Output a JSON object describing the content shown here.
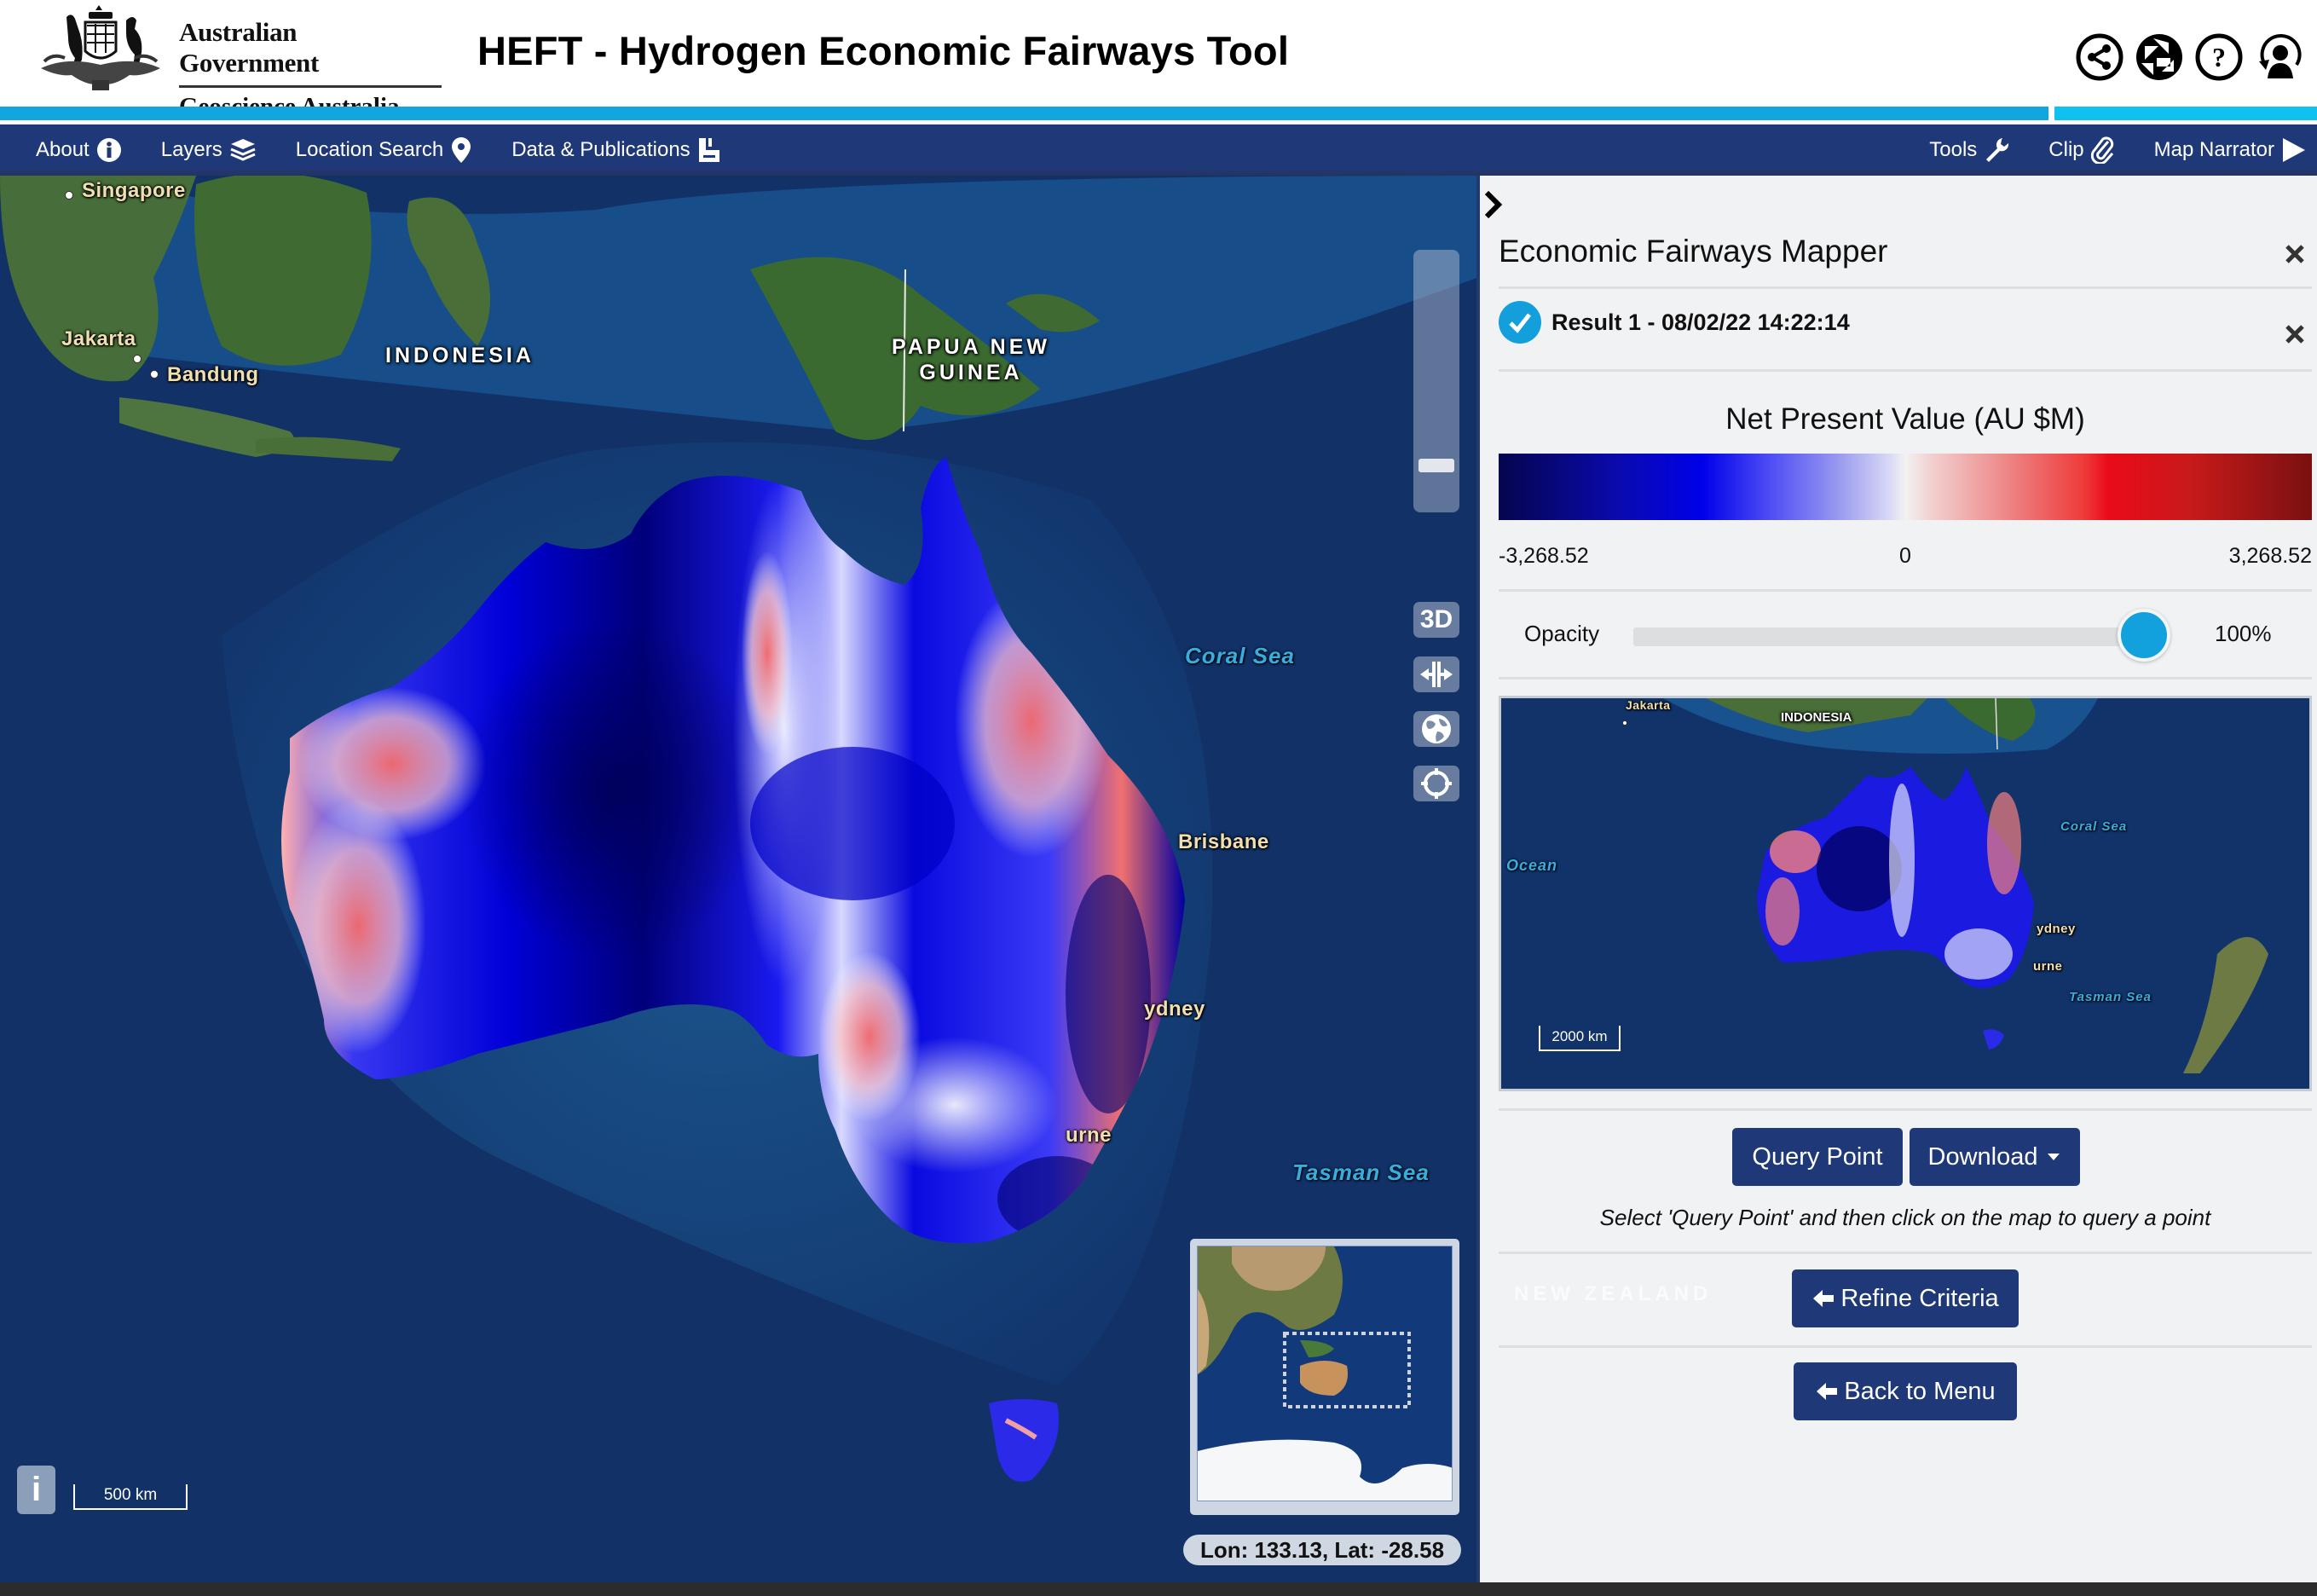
{
  "header": {
    "gov_line1": "Australian Government",
    "gov_line2": "Geoscience Australia",
    "title": "HEFT - Hydrogen Economic Fairways Tool",
    "icons": [
      "share-icon",
      "picasa-icon",
      "help-icon",
      "user-reset-icon"
    ]
  },
  "nav": {
    "left": [
      {
        "label": "About",
        "icon": "info-icon"
      },
      {
        "label": "Layers",
        "icon": "layers-icon"
      },
      {
        "label": "Location Search",
        "icon": "map-pin-icon"
      },
      {
        "label": "Data & Publications",
        "icon": "document-icon"
      }
    ],
    "right": [
      {
        "label": "Tools",
        "icon": "wrench-icon"
      },
      {
        "label": "Clip",
        "icon": "paperclip-icon"
      },
      {
        "label": "Map Narrator",
        "icon": "play-icon"
      }
    ]
  },
  "map": {
    "labels": {
      "singapore": "Singapore",
      "jakarta": "Jakarta",
      "bandung": "Bandung",
      "indonesia": "INDONESIA",
      "png_line1": "PAPUA NEW",
      "png_line2": "GUINEA",
      "coral_sea": "Coral Sea",
      "brisbane": "Brisbane",
      "sydney": "ydney",
      "melbourne": "urne",
      "tasman_sea": "Tasman Sea"
    },
    "controls": {
      "three_d": "3D",
      "info": "i"
    },
    "scale_bar": "500 km",
    "coordinates": "Lon: 133.13, Lat: -28.58"
  },
  "panel": {
    "title": "Economic Fairways Mapper",
    "result_label": "Result 1 - 08/02/22 14:22:14",
    "result_checked": true,
    "legend": {
      "title": "Net Present Value (AU $M)",
      "min": "-3,268.52",
      "mid": "0",
      "max": "3,268.52",
      "colors": [
        "#05054e",
        "#0000ea",
        "#f2f2f2",
        "#ea0a1a",
        "#7a1010"
      ]
    },
    "opacity": {
      "label": "Opacity",
      "value_text": "100%",
      "value": 1.0
    },
    "thumbnail": {
      "jakarta": "Jakarta",
      "indonesia": "INDONESIA",
      "ocean": "Ocean",
      "coral_sea": "Coral Sea",
      "sydney": "ydney",
      "melbourne": "urne",
      "tasman_sea": "Tasman Sea",
      "scale": "2000 km"
    },
    "buttons": {
      "query_point": "Query Point",
      "download": "Download",
      "refine": "Refine Criteria",
      "back": "Back to Menu"
    },
    "hint": "Select 'Query Point' and then click on the map to query a point",
    "ghost_label": "NEW ZEALAND"
  },
  "colors": {
    "nav_bg": "#1f3877",
    "stripe": "#12a6de",
    "stripe_alt": "#0ec1ef",
    "accent": "#12a1dc",
    "button_bg": "#1f3877",
    "panel_bg": "#f1f2f4"
  }
}
